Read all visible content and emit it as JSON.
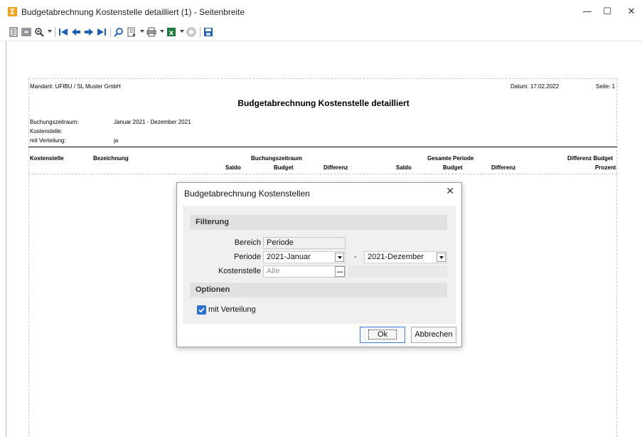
{
  "window": {
    "title": "Budgetabrechnung Kostenstelle detailliert (1) - Seitenbreite",
    "app_icon": "Σ",
    "minimize": "—",
    "maximize": "☐",
    "close": "✕"
  },
  "toolbar": {
    "icons": [
      "page-icon",
      "page-layout-icon",
      "zoom-icon",
      "first-page-icon",
      "prev-page-icon",
      "next-page-icon",
      "last-page-icon",
      "search-icon",
      "export-icon",
      "print-icon",
      "excel-icon",
      "stop-icon",
      "save-icon"
    ]
  },
  "report": {
    "mandant": "Mandant: UFIBU / SL Muster GmbH",
    "datum": "Datum:  17.02.2022",
    "seite": "Seite: 1",
    "title": "Budgetabrechnung Kostenstelle detailliert",
    "params": [
      {
        "label": "Buchungszeitraum:",
        "value": "Januar 2021 - Dezember 2021"
      },
      {
        "label": "Kostenstelle:",
        "value": ""
      },
      {
        "label": "mit Verteilung:",
        "value": "ja"
      }
    ],
    "columns": {
      "kostenstelle": "Kostenstelle",
      "bezeichnung": "Bezeichnung",
      "buchungszeitraum": "Buchungszeitraum",
      "gesamte_periode": "Gesamte Periode",
      "differenz_budget": "Differenz Budget",
      "saldo1": "Saldo",
      "budget1": "Budget",
      "differenz1": "Differenz",
      "saldo2": "Saldo",
      "budget2": "Budget",
      "differenz2": "Differenz",
      "prozent": "Prozent"
    }
  },
  "dialog": {
    "title": "Budgetabrechnung Kostenstellen",
    "close": "✕",
    "filterung": "Filterung",
    "bereich_label": "Bereich",
    "bereich_value": "Periode",
    "periode_label": "Periode",
    "periode_from": "2021-Januar",
    "periode_sep": "-",
    "periode_to": "2021-Dezember",
    "kostenstelle_label": "Kostenstelle",
    "kostenstelle_placeholder": "Alle",
    "ellipsis": "...",
    "optionen": "Optionen",
    "mit_verteilung": "mit Verteilung",
    "mit_verteilung_checked": true,
    "ok": "Ok",
    "abbrechen": "Abbrechen"
  }
}
